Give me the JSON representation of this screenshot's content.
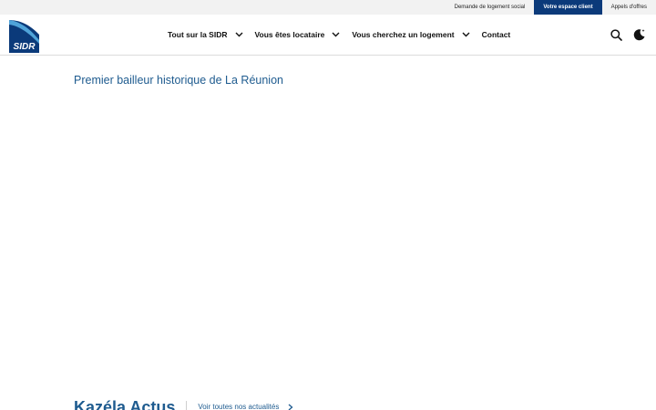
{
  "topbar": {
    "links": [
      {
        "label": "Demande de logement social"
      },
      {
        "label": "Votre espace client"
      },
      {
        "label": "Appels d'offres"
      }
    ]
  },
  "header": {
    "nav": [
      {
        "label": "Tout sur la SIDR"
      },
      {
        "label": "Vous êtes locataire"
      },
      {
        "label": "Vous cherchez un logement"
      },
      {
        "label": "Contact"
      }
    ]
  },
  "main": {
    "tagline": "Premier bailleur historique de La Réunion",
    "news_title": "Kazéla Actus",
    "news_link": "Voir toutes nos actualités"
  },
  "colors": {
    "brand_blue": "#0b3a7a",
    "text_blue": "#1e5b8f"
  },
  "icons": {
    "search": "search-icon",
    "theme": "dark-mode-icon"
  }
}
